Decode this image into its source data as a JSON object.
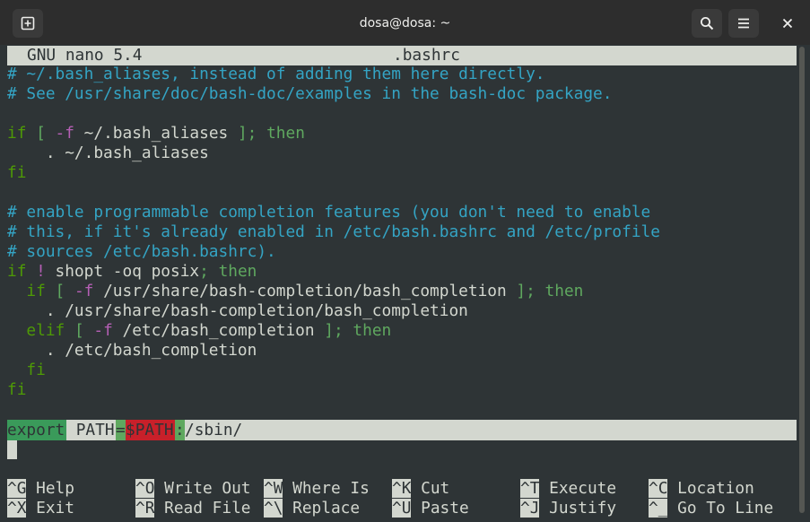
{
  "window": {
    "title": "dosa@dosa: ~"
  },
  "header": {
    "app": "GNU nano 5.4",
    "file": ".bashrc"
  },
  "lines": {
    "l1": "# ~/.bash_aliases, instead of adding them here directly.",
    "l2": "# See /usr/share/doc/bash-doc/examples in the bash-doc package.",
    "l4a": "if",
    "l4b": " [ ",
    "l4c": "-f",
    "l4d": " ~/.bash_aliases ",
    "l4e": "];",
    "l4f": " then",
    "l5": "    . ~/.bash_aliases",
    "l6": "fi",
    "l8": "# enable programmable completion features (you don't need to enable",
    "l9": "# this, if it's already enabled in /etc/bash.bashrc and /etc/profile",
    "l10": "# sources /etc/bash.bashrc).",
    "l11a": "if",
    "l11b": " ! ",
    "l11c": "shopt -oq posix",
    "l11d": ";",
    "l11e": " then",
    "l12a": "  if",
    "l12b": " [ ",
    "l12c": "-f",
    "l12d": " /usr/share/bash-completion/bash_completion ",
    "l12e": "];",
    "l12f": " then",
    "l13": "    . /usr/share/bash-completion/bash_completion",
    "l14a": "  elif",
    "l14b": " [ ",
    "l14c": "-f",
    "l14d": " /etc/bash_completion ",
    "l14e": "];",
    "l14f": " then",
    "l15": "    . /etc/bash_completion",
    "l16": "  fi",
    "l17": "fi",
    "exp_kw": "export",
    "exp_var": " PATH",
    "exp_eq": "=",
    "exp_ref": "$PATH",
    "exp_colon": ":",
    "exp_rest": "/sbin/"
  },
  "shortcuts": [
    {
      "key": "^G",
      "label": "Help"
    },
    {
      "key": "^O",
      "label": "Write Out"
    },
    {
      "key": "^W",
      "label": "Where Is"
    },
    {
      "key": "^K",
      "label": "Cut"
    },
    {
      "key": "^T",
      "label": "Execute"
    },
    {
      "key": "^C",
      "label": "Location"
    },
    {
      "key": "^X",
      "label": "Exit"
    },
    {
      "key": "^R",
      "label": "Read File"
    },
    {
      "key": "^\\",
      "label": "Replace"
    },
    {
      "key": "^U",
      "label": "Paste"
    },
    {
      "key": "^J",
      "label": "Justify"
    },
    {
      "key": "^_",
      "label": "Go To Line"
    }
  ]
}
